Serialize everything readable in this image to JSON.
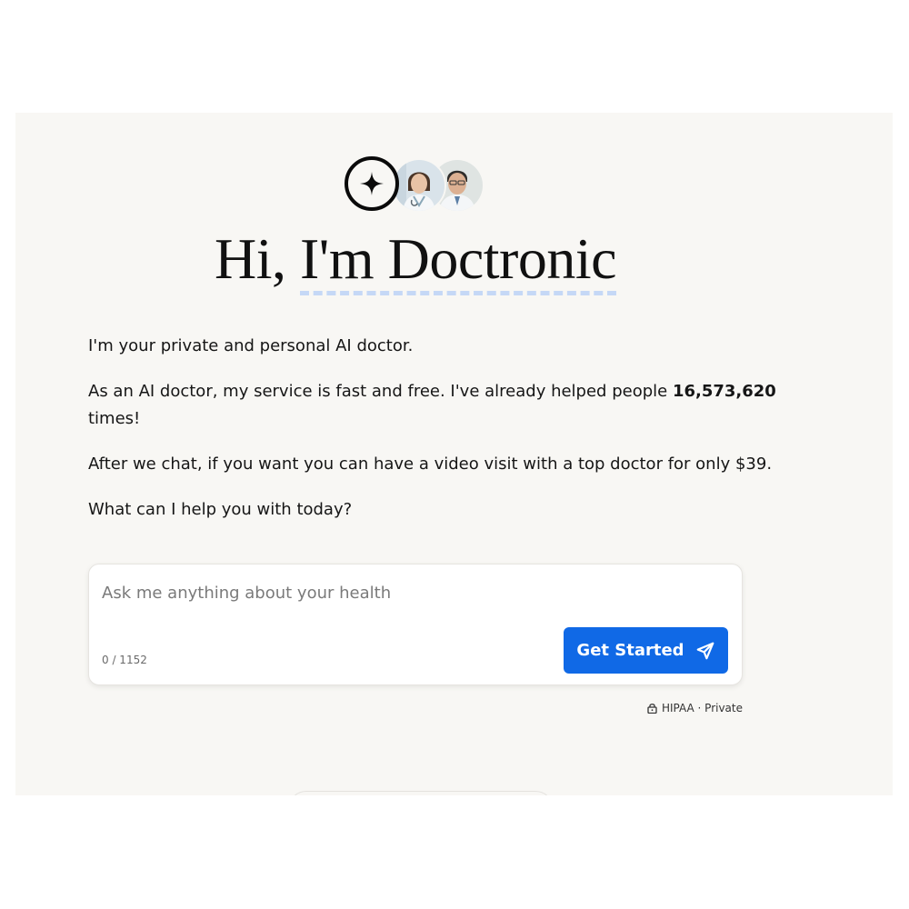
{
  "header": {
    "greeting": "Hi, ",
    "name": "I'm Doctronic"
  },
  "intro": {
    "line1": "I'm your private and personal AI doctor.",
    "line2_before": "As an AI doctor, my service is fast and free. I've already helped people ",
    "helped_count": "16,573,620",
    "line2_after": " times!",
    "line3": "After we chat, if you want you can have a video visit with a top doctor for only $39.",
    "line4": "What can I help you with today?"
  },
  "chat": {
    "placeholder": "Ask me anything about your health",
    "value": "",
    "char_count": "0 / 1152",
    "submit_label": "Get Started",
    "submit_icon": "send-icon"
  },
  "privacy": {
    "icon": "lock-icon",
    "label": "HIPAA · Private"
  },
  "colors": {
    "accent": "#1069e6",
    "panel_bg": "#f8f7f4",
    "underline": "#c5d8f6"
  }
}
